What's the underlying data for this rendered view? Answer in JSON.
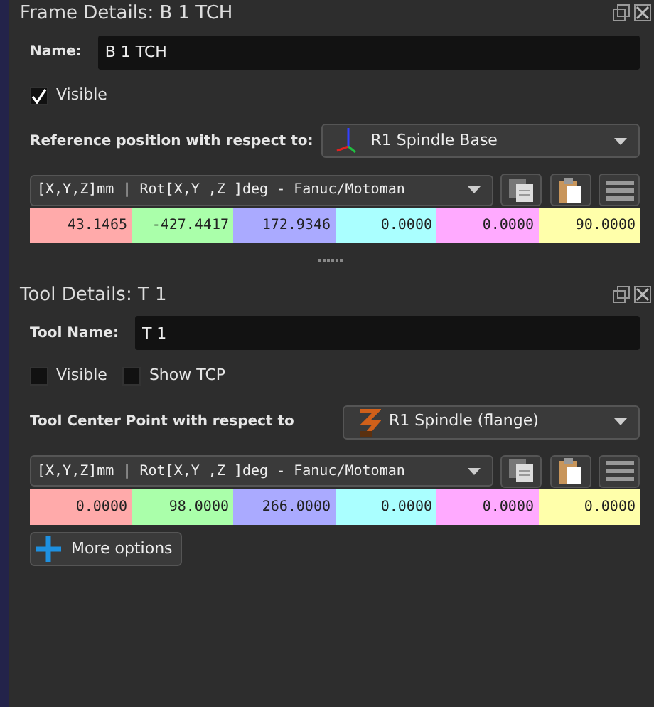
{
  "sections": [
    {
      "title": "Frame Details: B 1 TCH",
      "name_field": {
        "label": "Name:",
        "value": "B 1 TCH"
      },
      "checkboxes": [
        {
          "label": "Visible",
          "checked": true
        }
      ],
      "reference": {
        "label": "Reference position with respect to:",
        "value": "R1 Spindle Base",
        "kind": "frame"
      },
      "format": "[X,Y,Z]mm | Rot[X,Y ,Z  ]deg - Fanuc/Motoman",
      "values": [
        {
          "text": "43.1465",
          "color": "#ffaaaa"
        },
        {
          "text": "-427.4417",
          "color": "#aaffaa"
        },
        {
          "text": "172.9346",
          "color": "#aaaaff"
        },
        {
          "text": "0.0000",
          "color": "#aaffff"
        },
        {
          "text": "0.0000",
          "color": "#ffaaff"
        },
        {
          "text": "90.0000",
          "color": "#ffffaa"
        }
      ]
    },
    {
      "title": "Tool Details: T 1",
      "name_field": {
        "label": "Tool Name:",
        "value": "T 1"
      },
      "checkboxes": [
        {
          "label": "Visible",
          "checked": false
        },
        {
          "label": "Show TCP",
          "checked": false
        }
      ],
      "reference": {
        "label": "Tool Center Point with respect to",
        "value": "R1 Spindle (flange)",
        "kind": "robot"
      },
      "format": "[X,Y,Z]mm | Rot[X,Y ,Z  ]deg - Fanuc/Motoman",
      "values": [
        {
          "text": "0.0000",
          "color": "#ffaaaa"
        },
        {
          "text": "98.0000",
          "color": "#aaffaa"
        },
        {
          "text": "266.0000",
          "color": "#aaaaff"
        },
        {
          "text": "0.0000",
          "color": "#aaffff"
        },
        {
          "text": "0.0000",
          "color": "#ffaaff"
        },
        {
          "text": "0.0000",
          "color": "#ffffaa"
        }
      ],
      "more_button": "More options"
    }
  ]
}
